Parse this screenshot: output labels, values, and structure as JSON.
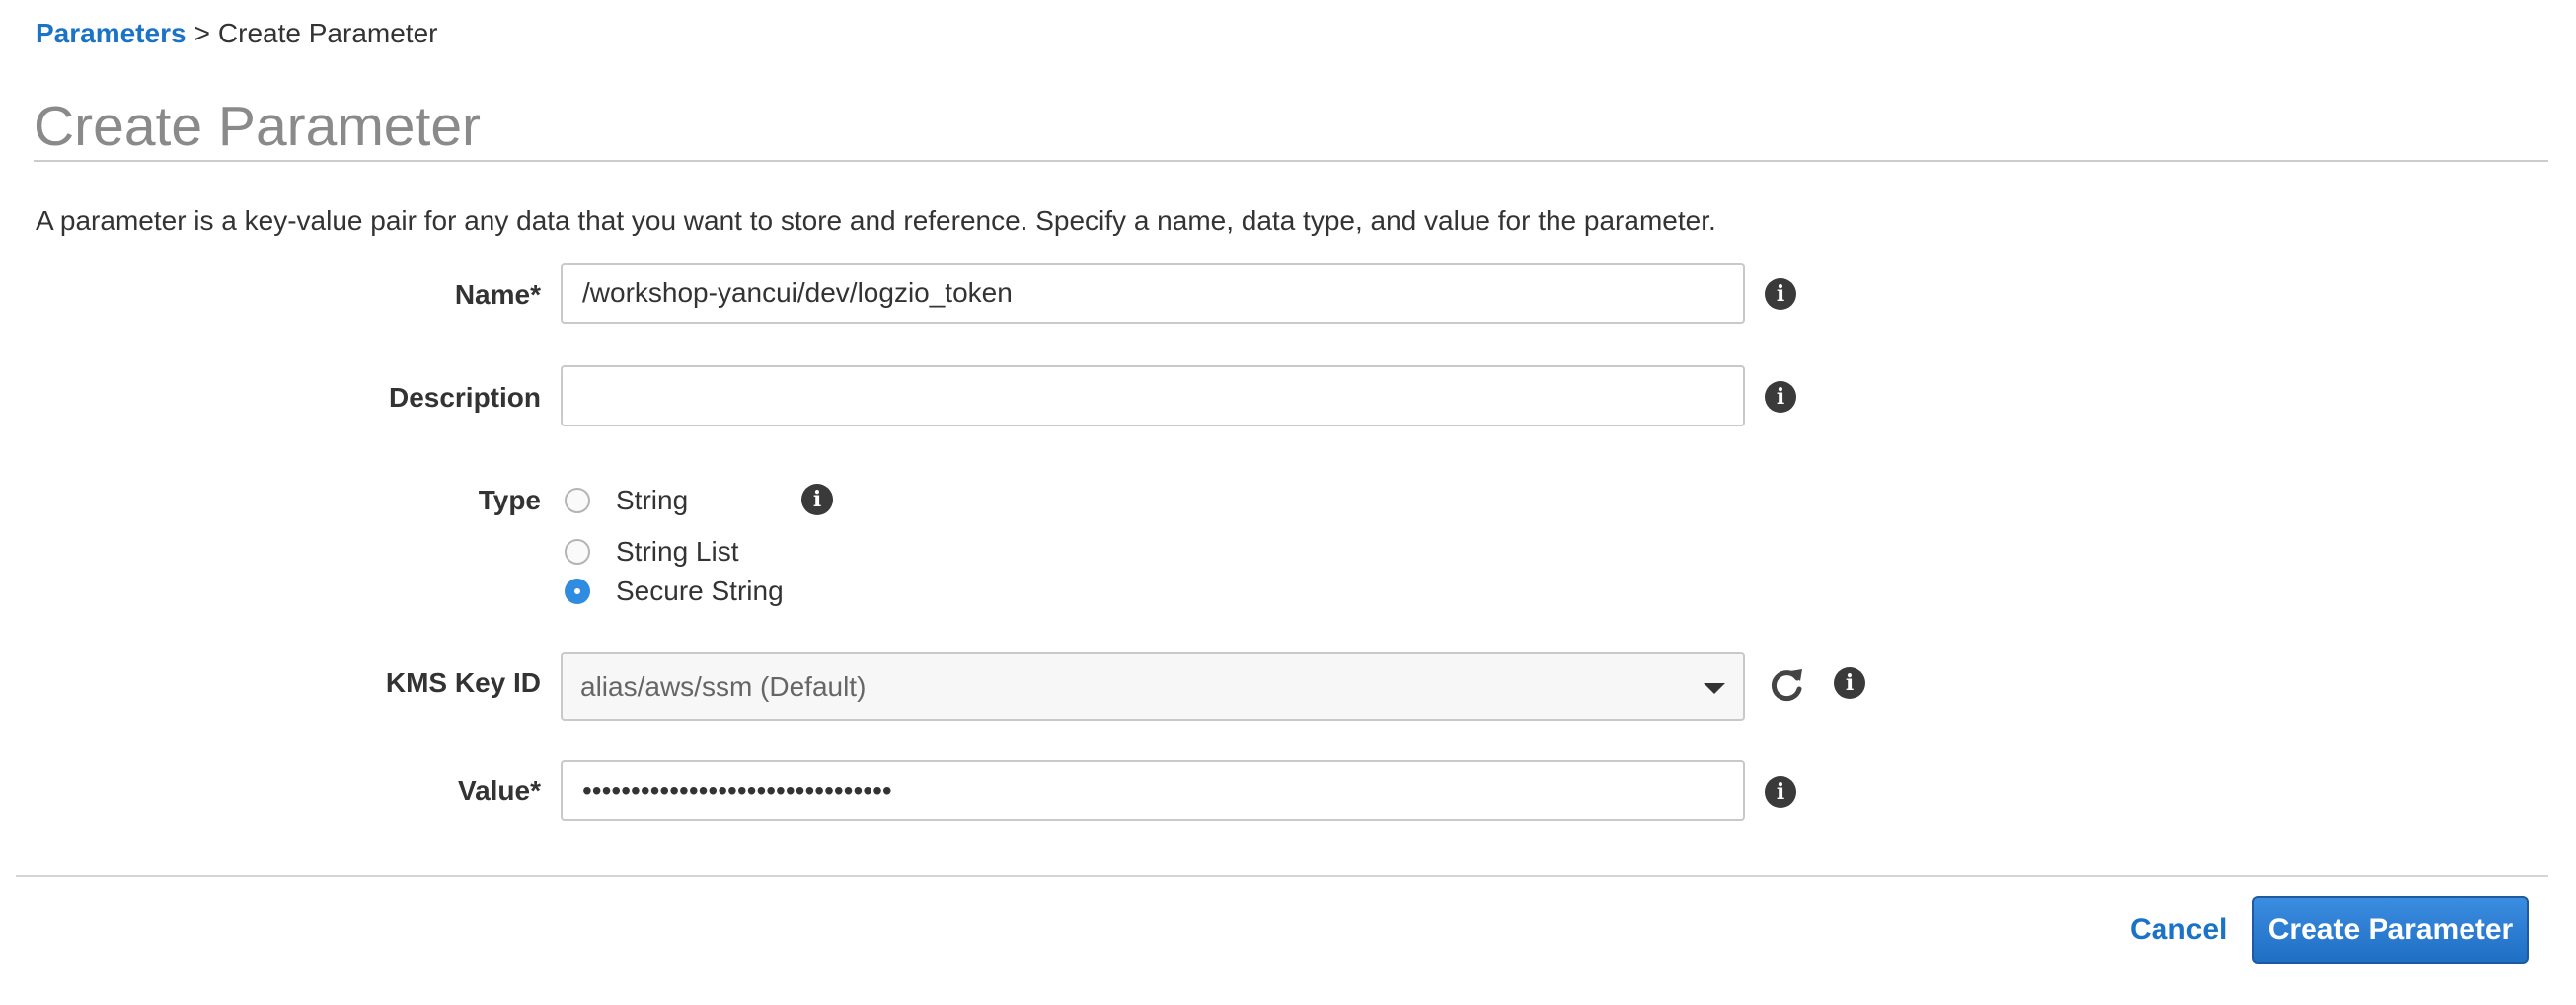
{
  "breadcrumb": {
    "parent": "Parameters",
    "separator": ">",
    "current": "Create Parameter"
  },
  "page_title": "Create Parameter",
  "intro": "A parameter is a key-value pair for any data that you want to store and reference. Specify a name, data type, and value for the parameter.",
  "form": {
    "name": {
      "label": "Name*",
      "value": "/workshop-yancui/dev/logzio_token"
    },
    "description": {
      "label": "Description",
      "value": ""
    },
    "type": {
      "label": "Type",
      "options": [
        {
          "label": "String",
          "checked": false
        },
        {
          "label": "String List",
          "checked": false
        },
        {
          "label": "Secure String",
          "checked": true
        }
      ]
    },
    "kms_key": {
      "label": "KMS Key ID",
      "selected": "alias/aws/ssm (Default)"
    },
    "value": {
      "label": "Value*",
      "masked": "••••••••••••••••••••••••••••••••"
    }
  },
  "icons": {
    "info": "info-icon",
    "refresh": "refresh-icon",
    "caret": "chevron-down-icon"
  },
  "colors": {
    "link": "#1a73c6",
    "primary_button": "#2a7ad4",
    "radio_checked": "#2f8ce0",
    "title": "#8a8a8a"
  },
  "actions": {
    "cancel": "Cancel",
    "submit": "Create Parameter"
  }
}
